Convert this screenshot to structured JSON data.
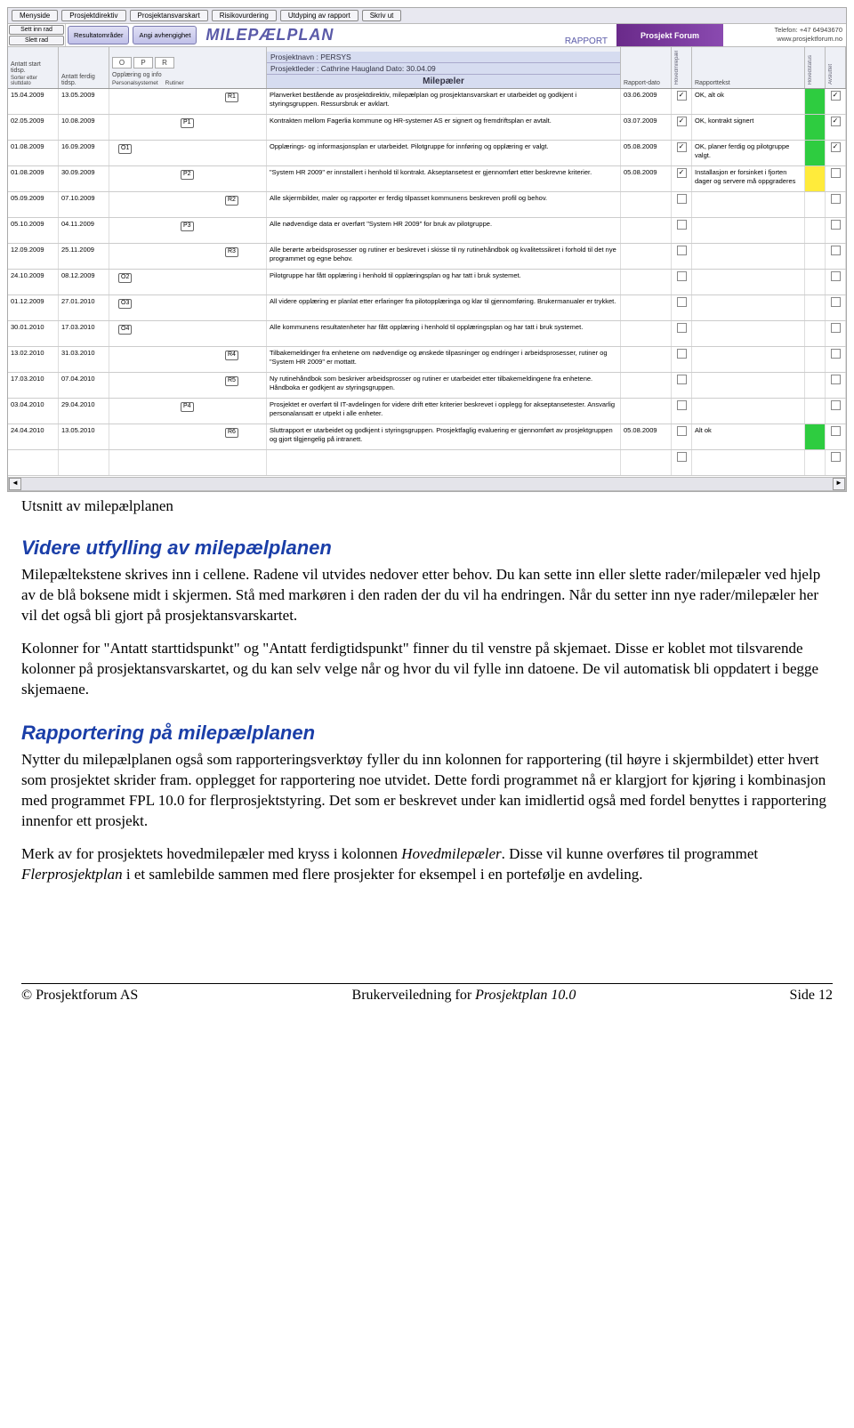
{
  "top_buttons": [
    "Menyside",
    "Prosjektdirektiv",
    "Prosjektansvarskart",
    "Risikovurdering",
    "Utdyping av rapport",
    "Skriv ut"
  ],
  "side_buttons": [
    "Sett inn rad",
    "Slett rad"
  ],
  "mid_buttons": [
    "Resultatområder",
    "Angi avhengighet"
  ],
  "app_title": "MILEPÆLPLAN",
  "rapport_label": "RAPPORT",
  "forum_label": "Prosjekt Forum",
  "contact": {
    "phone": "Telefon: +47 64943670",
    "url": "www.prosjektforum.no"
  },
  "col_headers": {
    "antatt_start": "Antatt start tidsp.",
    "antatt_ferdig": "Antatt ferdig tidsp.",
    "sorter": "Sorter etter sluttdato",
    "opr_title": "Opplæring og info",
    "opr_sub": [
      "Personalsystemet",
      "Rutiner"
    ],
    "opr_codes": [
      "O",
      "P",
      "R"
    ],
    "proj_name": "Prosjektnavn : PERSYS",
    "proj_leader": "Prosjektleder : Cathrine Haugland   Dato: 30.04.09",
    "mp_title": "Milepæler",
    "rapport_dato": "Rapport-dato",
    "hoved": "Hovedmilepæl",
    "rapport_tekst": "Rapporttekst",
    "hovedstatus": "Hovedstatus",
    "avsluttet": "Avsluttet"
  },
  "rows": [
    {
      "d1": "15.04.2009",
      "d2": "13.05.2009",
      "node": "R1",
      "nx": 130,
      "mp": "Planverket bestående av prosjektdirektiv, milepælplan og prosjektansvarskart er utarbeidet og godkjent i styringsgruppen. Ressursbruk er avklart.",
      "rd": "03.06.2009",
      "h": true,
      "rt": "OK, alt ok",
      "st": "g",
      "av": true
    },
    {
      "d1": "02.05.2009",
      "d2": "10.08.2009",
      "node": "P1",
      "nx": 80,
      "mp": "Kontrakten mellom Fagerlia kommune og HR-systemer AS er signert og fremdriftsplan er avtalt.",
      "rd": "03.07.2009",
      "h": true,
      "rt": "OK, kontrakt signert",
      "st": "g",
      "av": true
    },
    {
      "d1": "01.08.2009",
      "d2": "16.09.2009",
      "node": "O1",
      "nx": 10,
      "mp": "Opplærings- og informasjonsplan er utarbeidet. Pilotgruppe for innføring og opplæring er valgt.",
      "rd": "05.08.2009",
      "h": true,
      "rt": "OK, planer ferdig og pilotgruppe valgt.",
      "st": "g",
      "av": true
    },
    {
      "d1": "01.08.2009",
      "d2": "30.09.2009",
      "node": "P2",
      "nx": 80,
      "mp": "\"System HR 2009\" er innstallert i henhold til kontrakt. Akseptansetest er gjennomført etter beskrevne kriterier.",
      "rd": "05.08.2009",
      "h": true,
      "rt": "Installasjon er forsinket i fjorten dager og servere må oppgraderes",
      "st": "y",
      "av": false
    },
    {
      "d1": "05.09.2009",
      "d2": "07.10.2009",
      "node": "R2",
      "nx": 130,
      "mp": "Alle skjermbilder, maler og rapporter er ferdig tilpasset kommunens beskreven profil og behov.",
      "rd": "",
      "h": false,
      "rt": "",
      "st": "",
      "av": false
    },
    {
      "d1": "05.10.2009",
      "d2": "04.11.2009",
      "node": "P3",
      "nx": 80,
      "mp": "Alle nødvendige data er overført \"System HR 2009\" for bruk av pilotgruppe.",
      "rd": "",
      "h": false,
      "rt": "",
      "st": "",
      "av": false
    },
    {
      "d1": "12.09.2009",
      "d2": "25.11.2009",
      "node": "R3",
      "nx": 130,
      "mp": "Alle berørte arbeidsprosesser og rutiner er beskrevet i skisse til ny rutinehåndbok og kvalitetssikret i forhold til det nye programmet og egne behov.",
      "rd": "",
      "h": false,
      "rt": "",
      "st": "",
      "av": false
    },
    {
      "d1": "24.10.2009",
      "d2": "08.12.2009",
      "node": "O2",
      "nx": 10,
      "mp": "Pilotgruppe har fått opplæring i henhold til opplæringsplan og har tatt i bruk systemet.",
      "rd": "",
      "h": false,
      "rt": "",
      "st": "",
      "av": false
    },
    {
      "d1": "01.12.2009",
      "d2": "27.01.2010",
      "node": "O3",
      "nx": 10,
      "mp": "All videre opplæring er planlat etter erfaringer fra pilotopplæringa og klar til gjennomføring. Brukermanualer er trykket.",
      "rd": "",
      "h": false,
      "rt": "",
      "st": "",
      "av": false
    },
    {
      "d1": "30.01.2010",
      "d2": "17.03.2010",
      "node": "O4",
      "nx": 10,
      "mp": "Alle kommunens resultatenheter har fått opplæring i henhold til opplæringsplan og har tatt i bruk systemet.",
      "rd": "",
      "h": false,
      "rt": "",
      "st": "",
      "av": false
    },
    {
      "d1": "13.02.2010",
      "d2": "31.03.2010",
      "node": "R4",
      "nx": 130,
      "mp": "Tilbakemeldinger fra enhetene om nødvendige og ønskede tilpasninger og endringer i arbeidsprosesser, rutiner og \"System HR 2009\" er mottatt.",
      "rd": "",
      "h": false,
      "rt": "",
      "st": "",
      "av": false
    },
    {
      "d1": "17.03.2010",
      "d2": "07.04.2010",
      "node": "R5",
      "nx": 130,
      "mp": "Ny rutinehåndbok som beskriver arbeidsprosser og rutiner er utarbeidet etter tilbakemeldingene fra enhetene. Håndboka er godkjent av styringsgruppen.",
      "rd": "",
      "h": false,
      "rt": "",
      "st": "",
      "av": false
    },
    {
      "d1": "03.04.2010",
      "d2": "29.04.2010",
      "node": "P4",
      "nx": 80,
      "mp": "Prosjektet er overført til IT-avdelingen for videre drift etter kriterier beskrevet i opplegg for akseptansetester. Ansvarlig personalansatt er utpekt i alle enheter.",
      "rd": "",
      "h": false,
      "rt": "",
      "st": "",
      "av": false
    },
    {
      "d1": "24.04.2010",
      "d2": "13.05.2010",
      "node": "R6",
      "nx": 130,
      "mp": "Sluttrapport er utarbeidet og godkjent i styringsgruppen. Prosjektfaglig evaluering er gjennomført av prosjektgruppen og gjort tilgjengelig på intranett.",
      "rd": "05.08.2009",
      "h": false,
      "rt": "Alt ok",
      "st": "g",
      "av": false
    },
    {
      "d1": "",
      "d2": "",
      "node": "",
      "nx": 0,
      "mp": "",
      "rd": "",
      "h": false,
      "rt": "",
      "st": "",
      "av": false
    }
  ],
  "caption": "Utsnitt av milepælplanen",
  "doc": {
    "h1": "Videre utfylling av milepælplanen",
    "p1": "Milepæltekstene skrives inn i cellene. Radene vil utvides nedover etter behov. Du kan sette inn eller slette rader/milepæler ved hjelp av de blå boksene midt i skjermen. Stå med markøren i den raden der du vil ha endringen. Når du setter inn nye rader/milepæler her vil det også bli gjort på prosjektansvarskartet.",
    "p2": "Kolonner for \"Antatt starttidspunkt\" og \"Antatt ferdigtidspunkt\" finner du til venstre på skjemaet. Disse er koblet mot tilsvarende kolonner på prosjektansvarskartet, og du kan selv velge når og hvor du vil fylle inn datoene. De vil automatisk bli oppdatert i begge skjemaene.",
    "h2": "Rapportering på milepælplanen",
    "p3": "Nytter du milepælplanen også som rapporteringsverktøy fyller du inn kolonnen for rapportering (til høyre i skjermbildet) etter hvert som prosjektet skrider fram. opplegget for rapportering noe utvidet. Dette fordi programmet nå er klargjort for kjøring i kombinasjon med programmet FPL 10.0 for flerprosjektstyring. Det som er beskrevet under kan imidlertid også med fordel benyttes i rapportering innenfor ett prosjekt.",
    "p4a": "Merk av for prosjektets hovedmilepæler med kryss i kolonnen ",
    "p4i": "Hovedmilepæler",
    "p4b": ". Disse vil kunne overføres til programmet ",
    "p4i2": "Flerprosjektplan",
    "p4c": " i et samlebilde sammen med flere prosjekter for eksempel i en portefølje en avdeling."
  },
  "footer": {
    "left": "© Prosjektforum AS",
    "mid_pre": "Brukerveiledning for ",
    "mid_it": "Prosjektplan 10.0",
    "right": "Side 12"
  }
}
